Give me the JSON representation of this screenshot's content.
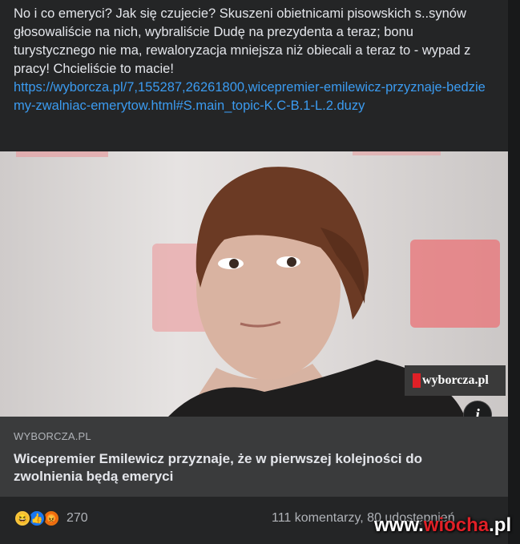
{
  "post": {
    "text": "No i co emeryci? Jak się czujecie? Skuszeni obietnicami pisowskich s..synów głosowaliście na nich, wybraliście Dudę na prezydenta a teraz; bonu turystycznego nie ma, rewaloryzacja mniejsza niż obiecali a teraz to - wypad z pracy! Chcieliście to macie!",
    "link": "https://wyborcza.pl/7,155287,26261800,wicepremier-emilewicz-przyznaje-bedziemy-zwalniac-emerytow.html#S.main_topic-K.C-B.1-L.2.duzy"
  },
  "image": {
    "watermark": "wyborcza.pl",
    "info_icon": "i"
  },
  "preview": {
    "domain": "WYBORCZA.PL",
    "headline": "Wicepremier Emilewicz przyznaje, że w pierwszej kolejności do zwolnienia będą emeryci"
  },
  "footer": {
    "reaction_icons": [
      "haha-icon",
      "like-icon",
      "angry-icon"
    ],
    "reaction_count": "270",
    "stats": "111 komentarzy, 80 udostępnień",
    "site_watermark_prefix": "www.",
    "site_watermark_brand": "wiocha",
    "site_watermark_suffix": ".pl"
  }
}
